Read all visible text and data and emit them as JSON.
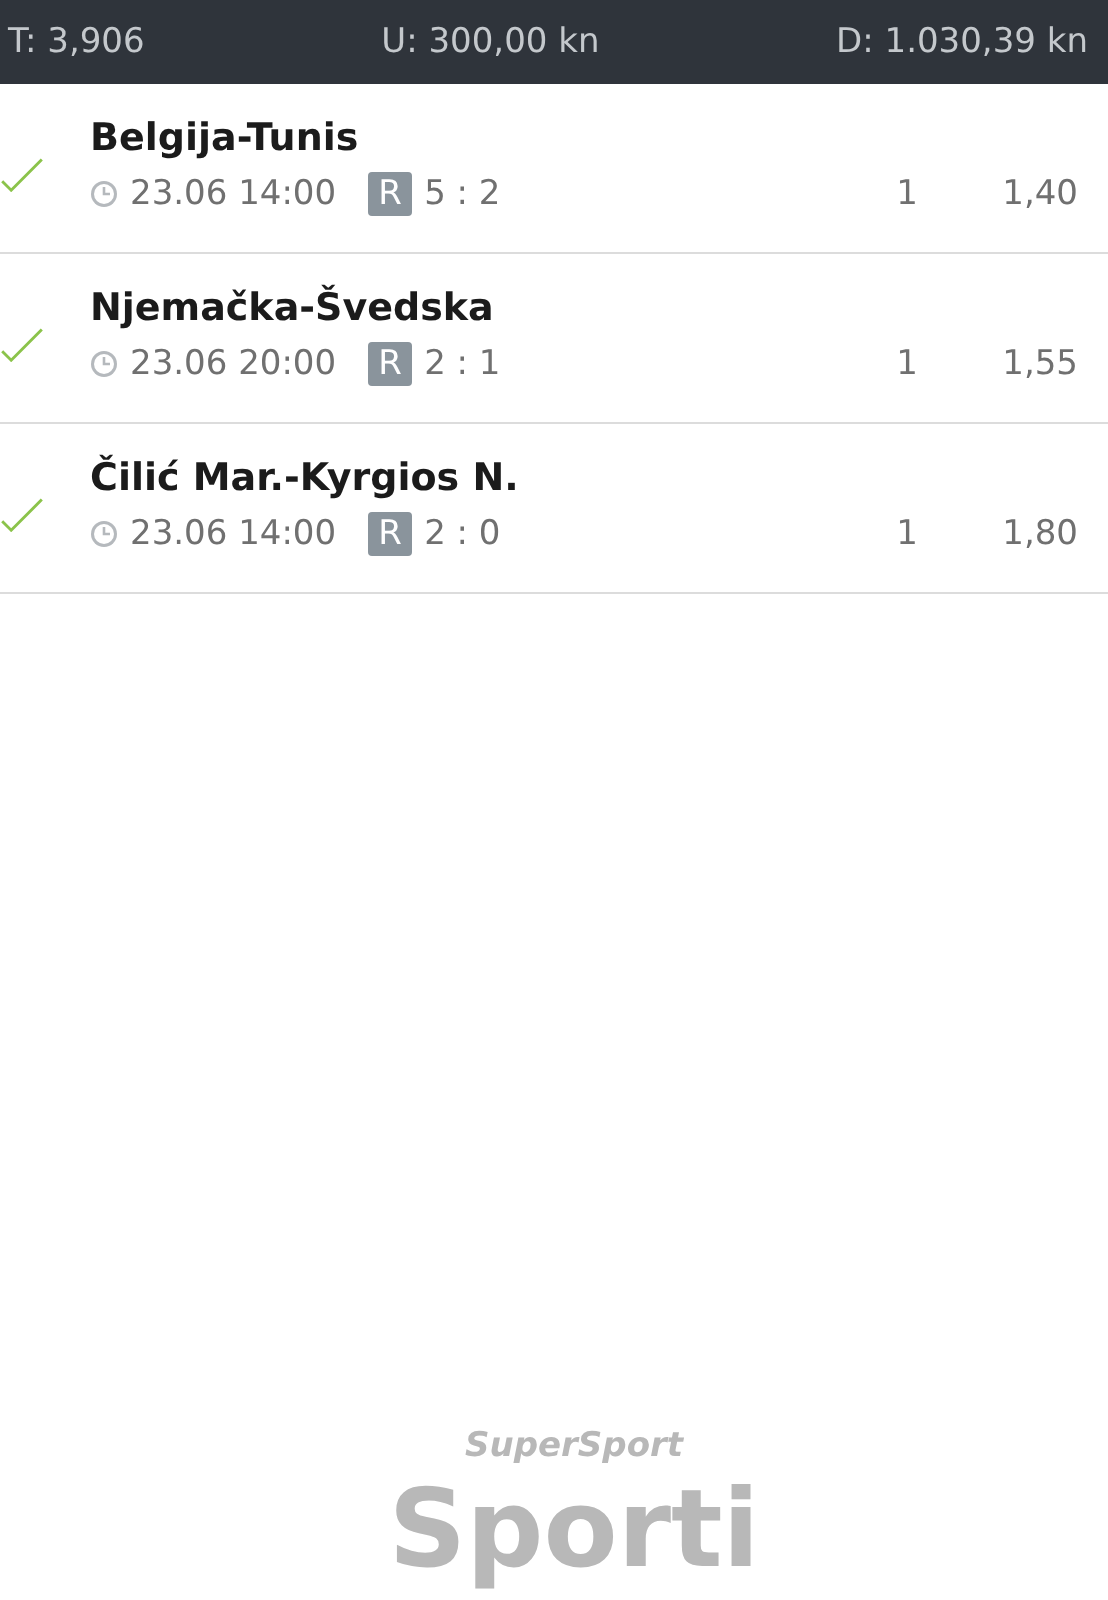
{
  "summary_bar": {
    "total_odds": "T: 3,906",
    "stake": "U: 300,00 kn",
    "payout": "D: 1.030,39 kn"
  },
  "bets": [
    {
      "match": "Belgija-Tunis",
      "time": "23.06 14:00",
      "badge": "R",
      "result": "5 : 2",
      "pick": "1",
      "odds": "1,40",
      "won": true
    },
    {
      "match": "Njemačka-Švedska",
      "time": "23.06 20:00",
      "badge": "R",
      "result": "2 : 1",
      "pick": "1",
      "odds": "1,55",
      "won": true
    },
    {
      "match": "Čilić Mar.-Kyrgios N.",
      "time": "23.06 14:00",
      "badge": "R",
      "result": "2 : 0",
      "pick": "1",
      "odds": "1,80",
      "won": true
    }
  ],
  "background_logo": {
    "brand": "SuperSport",
    "name": "Sporti"
  }
}
